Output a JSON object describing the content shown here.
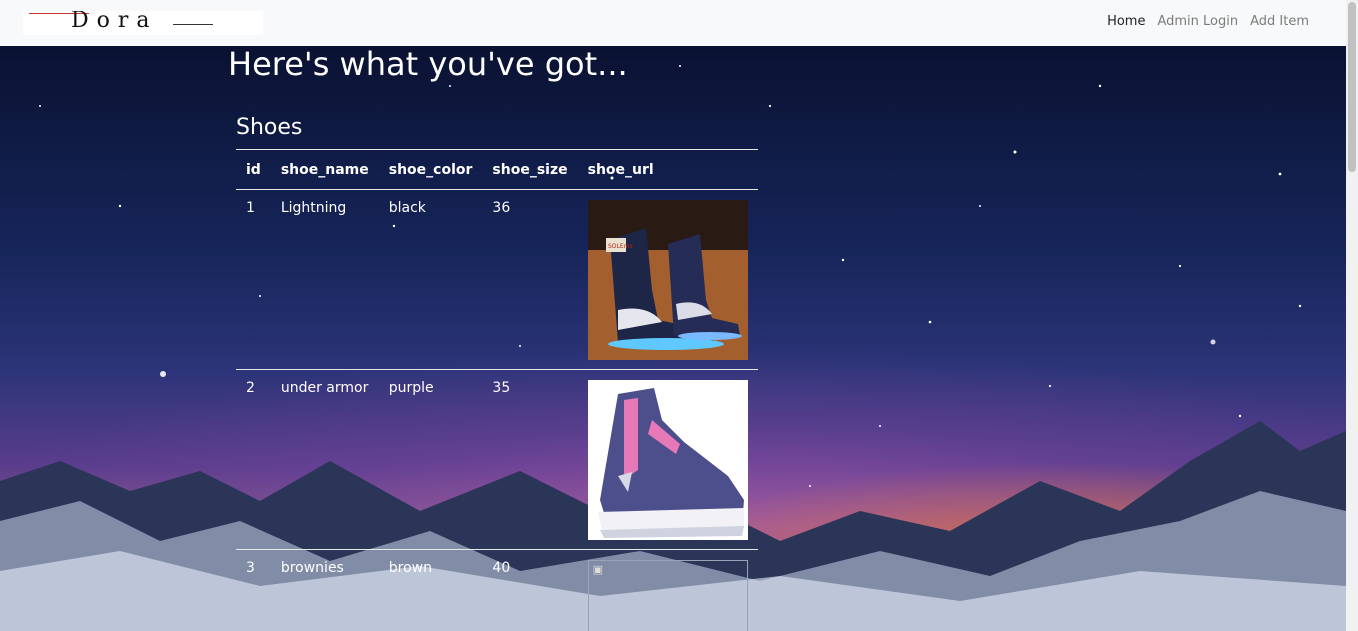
{
  "nav": {
    "brand": "Dora",
    "links": [
      {
        "label": "Home",
        "active": true
      },
      {
        "label": "Admin Login",
        "active": false
      },
      {
        "label": "Add Item",
        "active": false
      }
    ]
  },
  "page": {
    "title": "Here's what you've got...",
    "section_title": "Shoes"
  },
  "table": {
    "headers": [
      "id",
      "shoe_name",
      "shoe_color",
      "shoe_size",
      "shoe_url"
    ],
    "rows": [
      {
        "id": "1",
        "shoe_name": "Lightning",
        "shoe_color": "black",
        "shoe_size": "36",
        "image": "led-high-top-sneaker"
      },
      {
        "id": "2",
        "shoe_name": "under armor",
        "shoe_color": "purple",
        "shoe_size": "35",
        "image": "purple-pink-basketball-shoe"
      },
      {
        "id": "3",
        "shoe_name": "brownies",
        "shoe_color": "brown",
        "shoe_size": "40",
        "image": "broken-image"
      }
    ]
  },
  "colors": {
    "navbar_bg": "#f8f9fa",
    "text": "#ffffff",
    "nav_active": "#222222",
    "nav_inactive": "#7b7b7b"
  }
}
